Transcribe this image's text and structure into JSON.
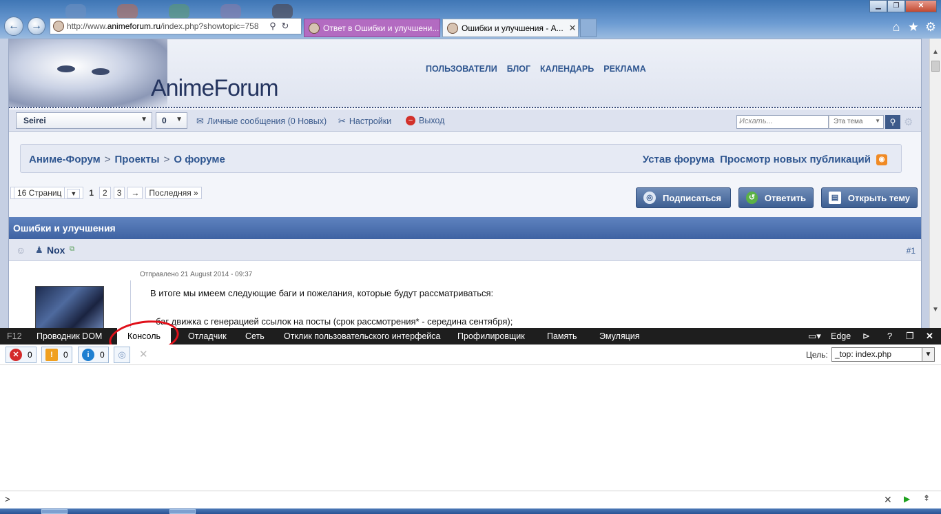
{
  "browser": {
    "url_prefix": "http://www.",
    "url_domain": "animeforum.ru",
    "url_suffix": "/index.php?showtopic=758",
    "tabs": [
      {
        "title": "Ответ в Ошибки и улучшени..."
      },
      {
        "title": "Ошибки и улучшения - А...",
        "close": "✕"
      }
    ]
  },
  "forum": {
    "logo": "AnimeForum",
    "topnav": [
      "ПОЛЬЗОВАТЕЛИ",
      "БЛОГ",
      "КАЛЕНДАРЬ",
      "РЕКЛАМА"
    ],
    "userbar": {
      "username": "Seirei",
      "count": "0",
      "messages": "Личные сообщения (0 Новых)",
      "settings": "Настройки",
      "logout": "Выход",
      "search_placeholder": "Искать...",
      "search_scope": "Эта тема"
    },
    "breadcrumb": [
      "Аниме-Форум",
      "Проекты",
      "О форуме"
    ],
    "breadcrumb_sep": ">",
    "crumb_links": [
      "Устав форума",
      "Просмотр новых публикаций"
    ],
    "pagination": {
      "pages_label": "16 Страниц",
      "current": "1",
      "pages": [
        "2",
        "3"
      ],
      "next": "→",
      "last": "Последняя »"
    },
    "actions": {
      "subscribe": "Подписаться",
      "reply": "Ответить",
      "new_topic": "Открыть тему"
    },
    "topic_title": "Ошибки и улучшения",
    "post": {
      "author": "Nox",
      "number": "#1",
      "date": "Отправлено 21 August 2014 - 09:37",
      "line1": "В итоге мы имеем следующие баги и пожелания, которые будут рассматриваться:",
      "line2": "- баг движка с генерацией ссылок на посты (срок рассмотрения* - середина сентября);"
    }
  },
  "devtools": {
    "f12": "F12",
    "tabs": [
      "Проводник DOM",
      "Консоль",
      "Отладчик",
      "Сеть",
      "Отклик пользовательского интерфейса",
      "Профилировщик",
      "Память",
      "Эмуляция"
    ],
    "mode": "Edge",
    "help": "?",
    "errors": "0",
    "warnings": "0",
    "info": "0",
    "target_label": "Цель:",
    "target_value": "_top: index.php",
    "prompt": ">"
  }
}
